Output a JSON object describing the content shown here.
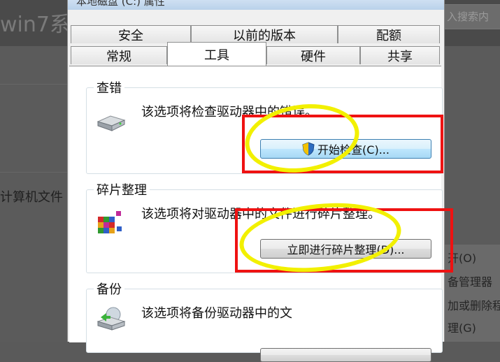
{
  "background": {
    "site_title": "win7系",
    "search_placeholder": "入搜索内",
    "left_text": "计算机文件",
    "context_menu": [
      "开(O)",
      "备管理器",
      "加或删除程",
      "理(G)"
    ]
  },
  "dialog": {
    "title": "本地磁盘 (C:) 属性",
    "tabs_row1": [
      "安全",
      "以前的版本",
      "配额"
    ],
    "tabs_row2": [
      "常规",
      "工具",
      "硬件",
      "共享"
    ],
    "active_tab": "工具",
    "groups": {
      "error_check": {
        "title": "查错",
        "description": "该选项将检查驱动器中的错误。",
        "button": "开始检查(C)..."
      },
      "defrag": {
        "title": "碎片整理",
        "description": "该选项将对驱动器中的文件进行碎片整理。",
        "button": "立即进行碎片整理(D)..."
      },
      "backup": {
        "title": "备份",
        "description": "该选项将备份驱动器中的文"
      }
    }
  },
  "icons": {
    "drive": "hard-drive-icon",
    "defrag": "defrag-icon",
    "backup": "backup-icon",
    "shield": "uac-shield-icon"
  },
  "colors": {
    "annotation_box": "#ef1212",
    "annotation_ring": "#f2f000",
    "primary_button": "#a7d9f5"
  }
}
